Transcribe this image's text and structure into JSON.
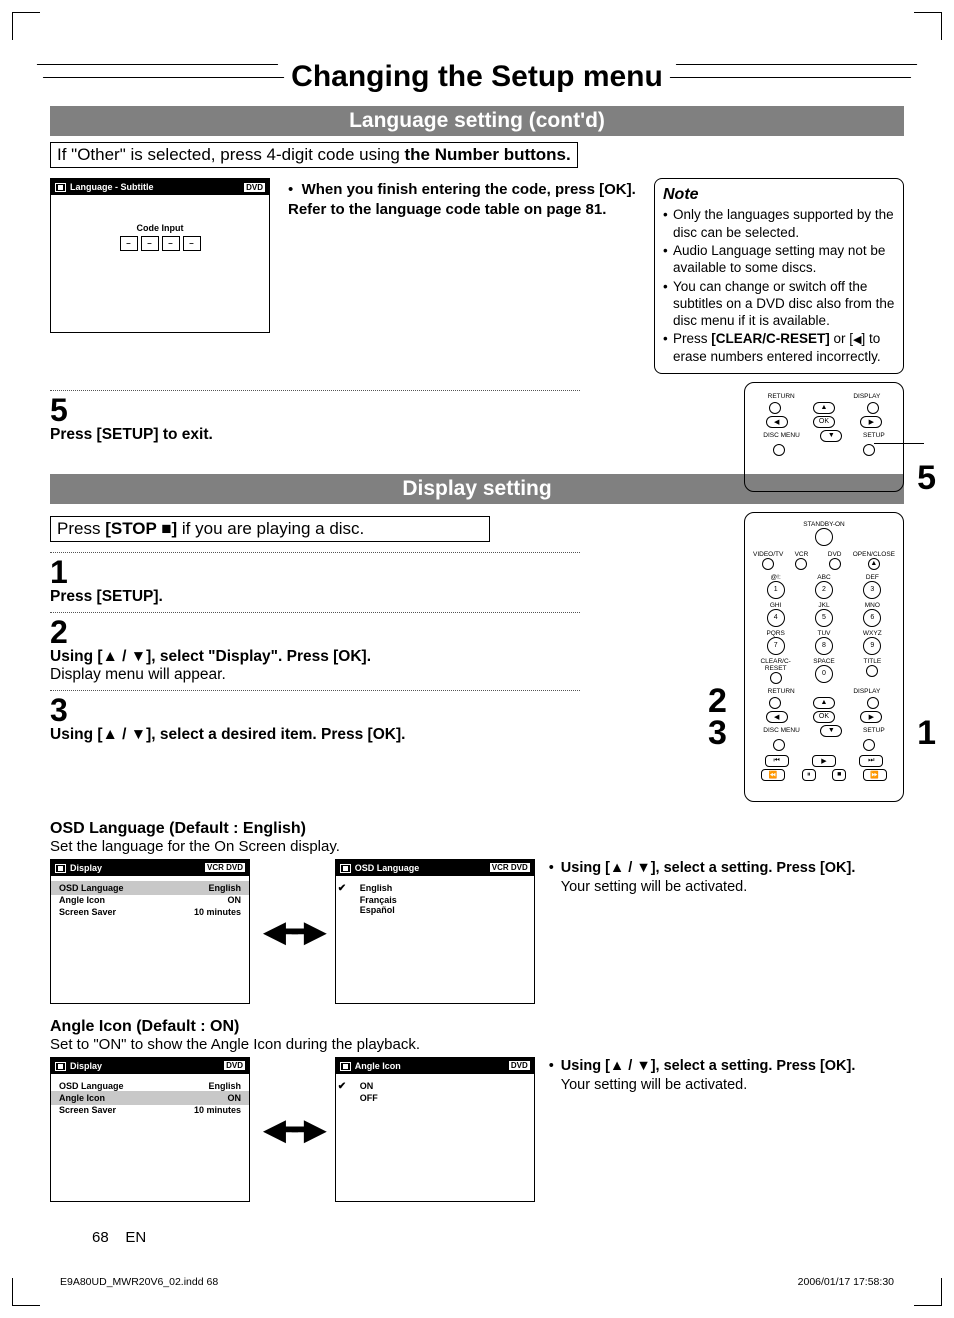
{
  "title": "Changing the Setup menu",
  "subtitle1": "Language setting (cont'd)",
  "other_hint_pre": "If \"Other\" is selected, press 4-digit code using ",
  "other_hint_bold": "the Number buttons.",
  "screen_lang": {
    "title": "Language - Subtitle",
    "tag": "DVD",
    "code_label": "Code Input",
    "dashes": [
      "–",
      "–",
      "–",
      "–"
    ]
  },
  "finish_instr_b1": "When you finish entering the code, press [OK]. Refer to the language code table on page 81.",
  "note": {
    "title": "Note",
    "items": [
      "Only the languages supported by the disc can be selected.",
      "Audio Language setting may not be available to some discs.",
      "You can change or switch off the subtitles on a DVD disc also from the disc menu if it is available.",
      "Press [CLEAR/C-RESET] or [◀] to erase numbers entered incorrectly."
    ]
  },
  "step5_num": "5",
  "step5_txt": "Press [SETUP] to exit.",
  "subtitle2": "Display setting",
  "stop_hint_pre": "Press ",
  "stop_hint_bold": "[STOP ■]",
  "stop_hint_post": " if you are playing a disc.",
  "step1_num": "1",
  "step1_txt": "Press [SETUP].",
  "step2_num": "2",
  "step2_txt": "Using [▲ / ▼], select \"Display\". Press [OK].",
  "step2_sub": "Display menu will appear.",
  "step3_num": "3",
  "step3_txt": "Using [▲ / ▼], select a desired item. Press [OK].",
  "osd_hdr": "OSD Language (Default : English)",
  "osd_sub": "Set the language for the On Screen display.",
  "display_screen": {
    "title": "Display",
    "tags": "VCR  DVD",
    "rows": [
      {
        "k": "OSD Language",
        "v": "English"
      },
      {
        "k": "Angle Icon",
        "v": "ON"
      },
      {
        "k": "Screen Saver",
        "v": "10 minutes"
      }
    ]
  },
  "osd_screen": {
    "title": "OSD Language",
    "tags": "VCR  DVD",
    "opts": [
      "English",
      "Français",
      "Español"
    ]
  },
  "select_instr_b": "Using [▲ / ▼], select a setting. Press [OK].",
  "select_instr_n": "Your setting will be activated.",
  "angle_hdr": "Angle Icon (Default : ON)",
  "angle_sub": "Set to \"ON\" to show the Angle Icon during the playback.",
  "angle_screen": {
    "title": "Angle Icon",
    "tags": "DVD",
    "opts": [
      "ON",
      "OFF"
    ]
  },
  "display_screen2_tags": "DVD",
  "remote_labels": {
    "return": "RETURN",
    "display": "DISPLAY",
    "ok": "OK",
    "discmenu": "DISC MENU",
    "setup": "SETUP",
    "standby": "STANDBY-ON",
    "videotv": "VIDEO/TV",
    "vcr": "VCR",
    "dvd": "DVD",
    "openclose": "OPEN/CLOSE",
    "abc": "ABC",
    "def": "DEF",
    "ghi": "GHI",
    "jkl": "JKL",
    "mno": "MNO",
    "pqrs": "PQRS",
    "tuv": "TUV",
    "wxyz": "WXYZ",
    "clear": "CLEAR/C-RESET",
    "space": "SPACE",
    "title": "TITLE",
    "at": "@!:"
  },
  "callouts": {
    "c5": "5",
    "c1": "1",
    "c2": "2",
    "c3": "3"
  },
  "footer_page": "68",
  "footer_lang": "EN",
  "print_file": "E9A80UD_MWR20V6_02.indd   68",
  "print_date": "2006/01/17   17:58:30"
}
